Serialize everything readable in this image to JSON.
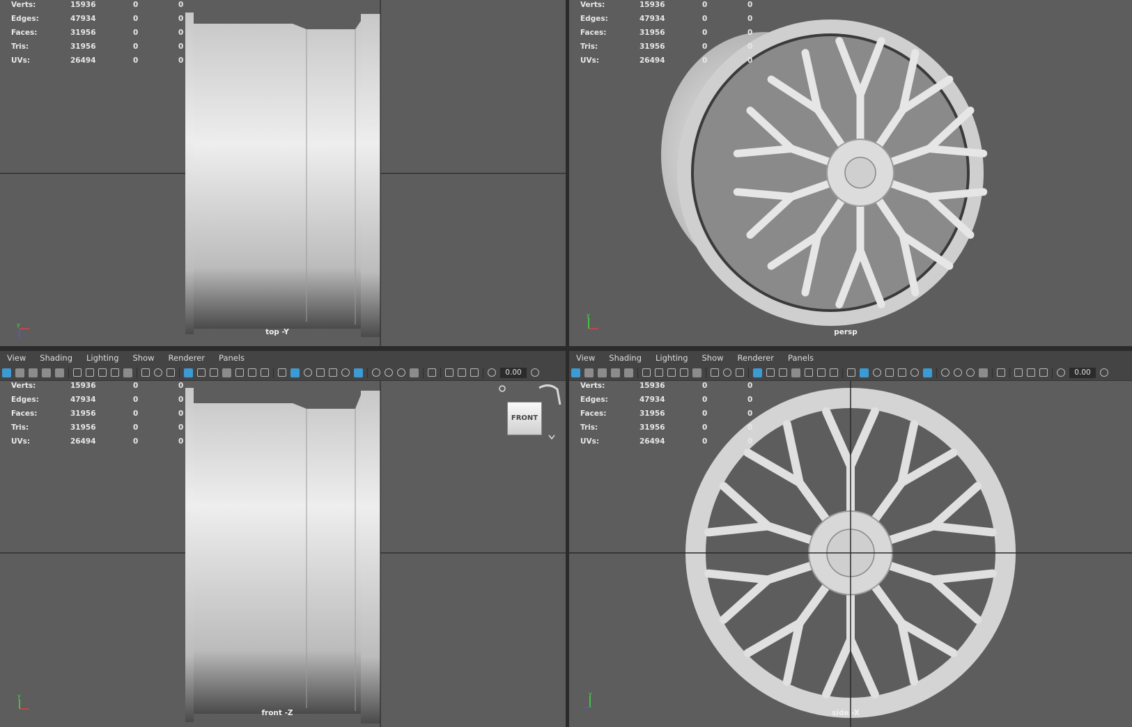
{
  "stats": {
    "labels": [
      "Verts:",
      "Edges:",
      "Faces:",
      "Tris:",
      "UVs:"
    ],
    "values": [
      [
        "15936",
        "0",
        "0"
      ],
      [
        "47934",
        "0",
        "0"
      ],
      [
        "31956",
        "0",
        "0"
      ],
      [
        "31956",
        "0",
        "0"
      ],
      [
        "26494",
        "0",
        "0"
      ]
    ]
  },
  "viewports": {
    "top": {
      "camera": "top -Y"
    },
    "persp": {
      "camera": "persp"
    },
    "front": {
      "camera": "front -Z"
    },
    "side": {
      "camera": "side -X"
    }
  },
  "menu": [
    "View",
    "Shading",
    "Lighting",
    "Show",
    "Renderer",
    "Panels"
  ],
  "toolbar": {
    "value": "0.00"
  },
  "viewcube": {
    "label": "FRONT"
  },
  "icons": [
    "select-camera-icon",
    "frame-all-icon",
    "grid-icon",
    "wireframe-icon",
    "smooth-shade-icon",
    "lights-icon",
    "exposure-icon",
    "viewcube-home-icon",
    "viewcube-rotate-icon",
    "viewcube-menu-icon"
  ],
  "colors": {
    "viewport_bg": "#5d5d5d",
    "panel_bg": "#444444",
    "highlight": "#3d9bd4",
    "wheel": "#d8d8d8"
  }
}
